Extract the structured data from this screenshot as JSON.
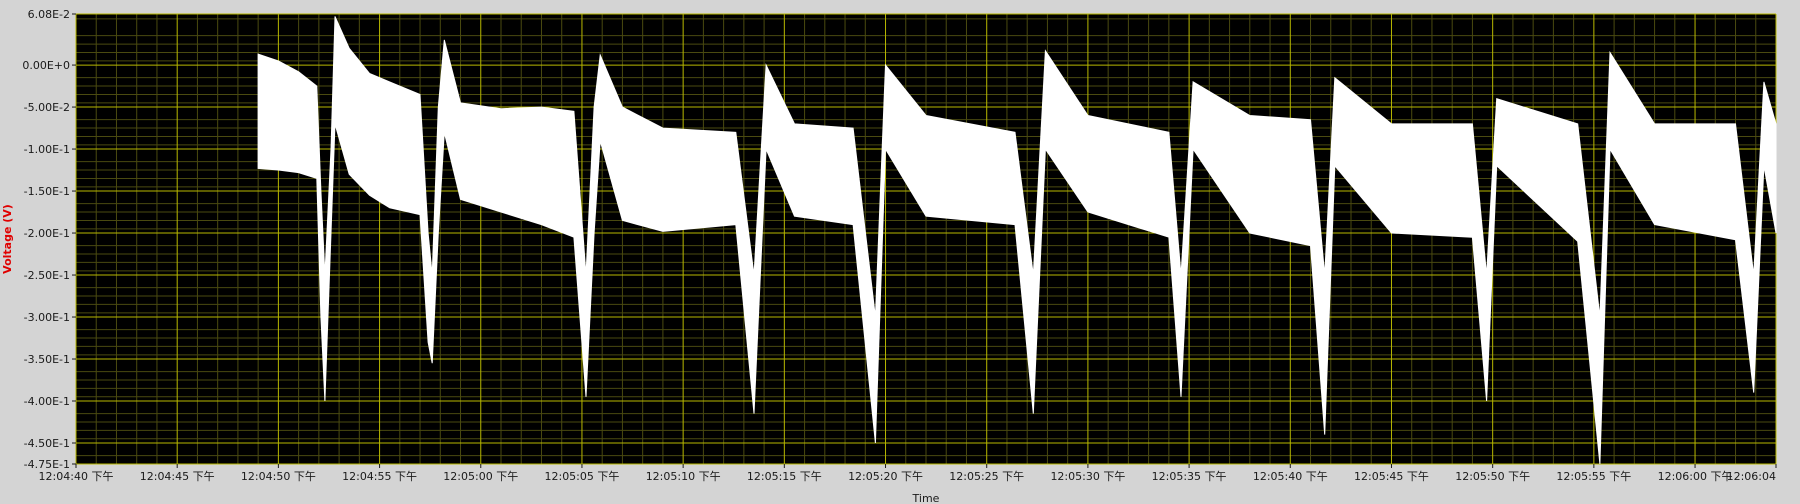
{
  "chart_data": {
    "type": "line",
    "title": "",
    "xlabel": "Time",
    "ylabel": "Voltage (V)",
    "ylim": [
      -0.475,
      0.0608
    ],
    "xlim": [
      "12:04:40",
      "12:06:04"
    ],
    "grid": true,
    "legend": "none",
    "colors": {
      "background": "#000000",
      "major_grid": "#b8b800",
      "minor_grid": "#4a4a10",
      "trace": "#ffffff",
      "ylabel": "#e00000",
      "frame": "#d4d4d4"
    },
    "y_ticks": [
      {
        "value": 0.0608,
        "label": "6.08E-2"
      },
      {
        "value": 0.0,
        "label": "0.00E+0"
      },
      {
        "value": -0.05,
        "label": "-5.00E-2"
      },
      {
        "value": -0.1,
        "label": "-1.00E-1"
      },
      {
        "value": -0.15,
        "label": "-1.50E-1"
      },
      {
        "value": -0.2,
        "label": "-2.00E-1"
      },
      {
        "value": -0.25,
        "label": "-2.50E-1"
      },
      {
        "value": -0.3,
        "label": "-3.00E-1"
      },
      {
        "value": -0.35,
        "label": "-3.50E-1"
      },
      {
        "value": -0.4,
        "label": "-4.00E-1"
      },
      {
        "value": -0.45,
        "label": "-4.50E-1"
      },
      {
        "value": -0.475,
        "label": "-4.75E-1"
      }
    ],
    "x_ticks": [
      {
        "time": "12:04:40",
        "label": "12:04:40 下午"
      },
      {
        "time": "12:04:45",
        "label": "12:04:45 下午"
      },
      {
        "time": "12:04:50",
        "label": "12:04:50 下午"
      },
      {
        "time": "12:04:55",
        "label": "12:04:55 下午"
      },
      {
        "time": "12:05:00",
        "label": "12:05:00 下午"
      },
      {
        "time": "12:05:05",
        "label": "12:05:05 下午"
      },
      {
        "time": "12:05:10",
        "label": "12:05:10 下午"
      },
      {
        "time": "12:05:15",
        "label": "12:05:15 下午"
      },
      {
        "time": "12:05:20",
        "label": "12:05:20 下午"
      },
      {
        "time": "12:05:25",
        "label": "12:05:25 下午"
      },
      {
        "time": "12:05:30",
        "label": "12:05:30 下午"
      },
      {
        "time": "12:05:35",
        "label": "12:05:35 下午"
      },
      {
        "time": "12:06:00",
        "label": "12:06:00 下午"
      },
      {
        "time": "12:06:04",
        "label": "12:06:04"
      }
    ],
    "x_ticks_extra": [
      {
        "time": "12:05:40",
        "label": "12:05:40 下午"
      },
      {
        "time": "12:05:45",
        "label": "12:05:45 下午"
      },
      {
        "time": "12:05:50",
        "label": "12:05:50 下午"
      },
      {
        "time": "12:05:55",
        "label": "12:05:55 下午"
      }
    ],
    "series": [
      {
        "color": "#ffffff",
        "envelope": [
          {
            "time": "12:04:49.0",
            "y_top": 0.013,
            "y_bottom": -0.123
          },
          {
            "time": "12:04:50.0",
            "y_top": 0.005,
            "y_bottom": -0.125
          },
          {
            "time": "12:04:51.0",
            "y_top": -0.008,
            "y_bottom": -0.128
          },
          {
            "time": "12:04:51.9",
            "y_top": -0.025,
            "y_bottom": -0.135
          },
          {
            "time": "12:04:52.1",
            "y_top": -0.15,
            "y_bottom": -0.3
          },
          {
            "time": "12:04:52.3",
            "y_top": -0.25,
            "y_bottom": -0.4
          },
          {
            "time": "12:04:52.6",
            "y_top": -0.1,
            "y_bottom": -0.2
          },
          {
            "time": "12:04:52.8",
            "y_top": 0.058,
            "y_bottom": -0.07
          },
          {
            "time": "12:04:53.5",
            "y_top": 0.02,
            "y_bottom": -0.13
          },
          {
            "time": "12:04:54.5",
            "y_top": -0.01,
            "y_bottom": -0.155
          },
          {
            "time": "12:04:55.5",
            "y_top": -0.02,
            "y_bottom": -0.17
          },
          {
            "time": "12:04:57.0",
            "y_top": -0.035,
            "y_bottom": -0.178
          },
          {
            "time": "12:04:57.4",
            "y_top": -0.2,
            "y_bottom": -0.33
          },
          {
            "time": "12:04:57.6",
            "y_top": -0.25,
            "y_bottom": -0.355
          },
          {
            "time": "12:04:57.9",
            "y_top": -0.05,
            "y_bottom": -0.2
          },
          {
            "time": "12:04:58.2",
            "y_top": 0.03,
            "y_bottom": -0.08
          },
          {
            "time": "12:04:59.0",
            "y_top": -0.045,
            "y_bottom": -0.16
          },
          {
            "time": "12:05:01.0",
            "y_top": -0.052,
            "y_bottom": -0.175
          },
          {
            "time": "12:05:03.0",
            "y_top": -0.05,
            "y_bottom": -0.19
          },
          {
            "time": "12:05:04.6",
            "y_top": -0.055,
            "y_bottom": -0.205
          },
          {
            "time": "12:05:05.2",
            "y_top": -0.25,
            "y_bottom": -0.395
          },
          {
            "time": "12:05:05.6",
            "y_top": -0.05,
            "y_bottom": -0.2
          },
          {
            "time": "12:05:05.9",
            "y_top": 0.012,
            "y_bottom": -0.09
          },
          {
            "time": "12:05:07.0",
            "y_top": -0.05,
            "y_bottom": -0.185
          },
          {
            "time": "12:05:09.0",
            "y_top": -0.075,
            "y_bottom": -0.198
          },
          {
            "time": "12:05:12.6",
            "y_top": -0.08,
            "y_bottom": -0.19
          },
          {
            "time": "12:05:13.5",
            "y_top": -0.25,
            "y_bottom": -0.415
          },
          {
            "time": "12:05:14.1",
            "y_top": 0.0,
            "y_bottom": -0.1
          },
          {
            "time": "12:05:15.5",
            "y_top": -0.07,
            "y_bottom": -0.18
          },
          {
            "time": "12:05:18.4",
            "y_top": -0.075,
            "y_bottom": -0.19
          },
          {
            "time": "12:05:19.5",
            "y_top": -0.3,
            "y_bottom": -0.45
          },
          {
            "time": "12:05:20.0",
            "y_top": 0.0,
            "y_bottom": -0.1
          },
          {
            "time": "12:05:22.0",
            "y_top": -0.06,
            "y_bottom": -0.18
          },
          {
            "time": "12:05:26.4",
            "y_top": -0.08,
            "y_bottom": -0.19
          },
          {
            "time": "12:05:27.3",
            "y_top": -0.25,
            "y_bottom": -0.415
          },
          {
            "time": "12:05:27.9",
            "y_top": 0.017,
            "y_bottom": -0.1
          },
          {
            "time": "12:05:30.0",
            "y_top": -0.06,
            "y_bottom": -0.175
          },
          {
            "time": "12:05:34.0",
            "y_top": -0.08,
            "y_bottom": -0.205
          },
          {
            "time": "12:05:34.6",
            "y_top": -0.25,
            "y_bottom": -0.395
          },
          {
            "time": "12:05:35.2",
            "y_top": -0.02,
            "y_bottom": -0.1
          },
          {
            "time": "12:05:38.0",
            "y_top": -0.06,
            "y_bottom": -0.2
          },
          {
            "time": "12:05:41.0",
            "y_top": -0.065,
            "y_bottom": -0.215
          },
          {
            "time": "12:05:41.7",
            "y_top": -0.25,
            "y_bottom": -0.44
          },
          {
            "time": "12:05:42.2",
            "y_top": -0.015,
            "y_bottom": -0.12
          },
          {
            "time": "12:05:45.0",
            "y_top": -0.07,
            "y_bottom": -0.2
          },
          {
            "time": "12:05:49.0",
            "y_top": -0.07,
            "y_bottom": -0.205
          },
          {
            "time": "12:05:49.7",
            "y_top": -0.25,
            "y_bottom": -0.4
          },
          {
            "time": "12:05:50.2",
            "y_top": -0.04,
            "y_bottom": -0.12
          },
          {
            "time": "12:05:54.2",
            "y_top": -0.07,
            "y_bottom": -0.21
          },
          {
            "time": "12:05:55.3",
            "y_top": -0.3,
            "y_bottom": -0.475
          },
          {
            "time": "12:05:55.8",
            "y_top": 0.015,
            "y_bottom": -0.1
          },
          {
            "time": "12:05:58.0",
            "y_top": -0.07,
            "y_bottom": -0.19
          },
          {
            "time": "12:06:02.0",
            "y_top": -0.07,
            "y_bottom": -0.208
          },
          {
            "time": "12:06:02.9",
            "y_top": -0.25,
            "y_bottom": -0.39
          },
          {
            "time": "12:06:03.4",
            "y_top": -0.02,
            "y_bottom": -0.12
          },
          {
            "time": "12:06:04.0",
            "y_top": -0.07,
            "y_bottom": -0.2
          }
        ]
      }
    ]
  }
}
